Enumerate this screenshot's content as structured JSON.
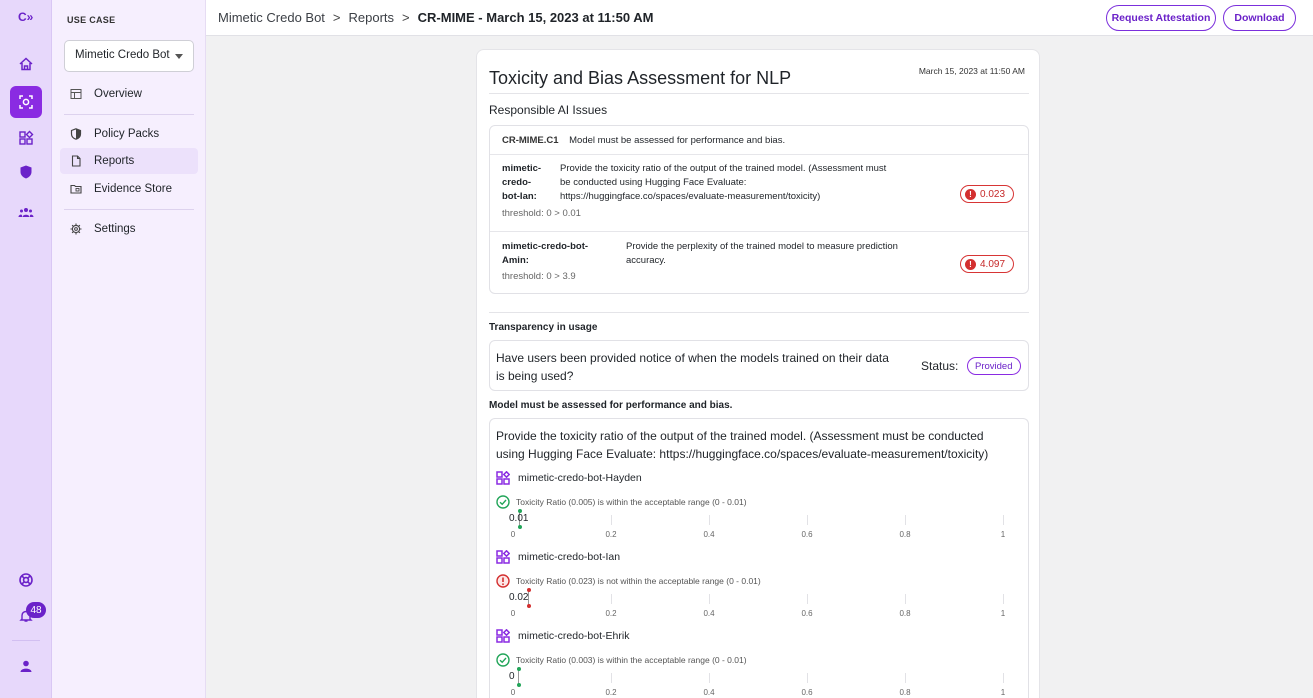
{
  "rail": {
    "logo": "C»",
    "notifications_count": "48"
  },
  "sidebar": {
    "heading": "USE CASE",
    "selected_use_case": "Mimetic Credo Bot",
    "items": [
      {
        "label": "Overview"
      },
      {
        "label": "Policy Packs"
      },
      {
        "label": "Reports"
      },
      {
        "label": "Evidence Store"
      },
      {
        "label": "Settings"
      }
    ]
  },
  "header": {
    "crumb_1": "Mimetic Credo Bot",
    "crumb_2": "Reports",
    "crumb_current": "CR-MIME - March 15, 2023 at 11:50 AM",
    "sep": ">",
    "request_attestation": "Request Attestation",
    "download": "Download"
  },
  "report": {
    "title": "Toxicity and Bias Assessment for NLP",
    "date": "March 15, 2023 at 11:50 AM",
    "issues_heading": "Responsible AI Issues",
    "policy": {
      "id": "CR-MIME.C1",
      "text": "Model must be assessed for performance and bias."
    },
    "issues": [
      {
        "model_1": "mimetic-",
        "model_2": "credo-",
        "model_3": "bot-Ian:",
        "desc_1": "Provide the toxicity ratio of the output of the trained model. (Assessment must",
        "desc_2": "be conducted using Hugging Face Evaluate:",
        "desc_3": "https://huggingface.co/spaces/evaluate-measurement/toxicity)",
        "threshold": "threshold: 0 > 0.01",
        "value": "0.023"
      },
      {
        "model_1": "mimetic-credo-bot-",
        "model_2": "Amin:",
        "desc_1": "Provide the perplexity of the trained model to measure prediction",
        "desc_2": "accuracy.",
        "threshold": "threshold: 0 > 3.9",
        "value": "4.097"
      }
    ],
    "transparency": {
      "heading": "Transparency in usage",
      "question_1": "Have users been provided notice of when the models trained on their data",
      "question_2": "is being used?",
      "status_label": "Status:",
      "status_value": "Provided"
    },
    "performance": {
      "heading": "Model must be assessed for performance and bias.",
      "desc_1": "Provide the toxicity ratio of the output of the trained model. (Assessment must be conducted",
      "desc_2": "using Hugging Face Evaluate: https://huggingface.co/spaces/evaluate-measurement/toxicity)",
      "axis_ticks": [
        "0",
        "0.2",
        "0.4",
        "0.6",
        "0.8",
        "1"
      ],
      "models": [
        {
          "name": "mimetic-credo-bot-Hayden",
          "status": "Toxicity Ratio (0.005) is within the acceptable range (0 - 0.01)",
          "value_label": "0.01",
          "value": 0.005,
          "ok": true
        },
        {
          "name": "mimetic-credo-bot-Ian",
          "status": "Toxicity Ratio (0.023) is not within the acceptable range (0 - 0.01)",
          "value_label": "0.02",
          "value": 0.023,
          "ok": false
        },
        {
          "name": "mimetic-credo-bot-Ehrik",
          "status": "Toxicity Ratio (0.003) is within the acceptable range (0 - 0.01)",
          "value_label": "0",
          "value": 0.003,
          "ok": true
        }
      ]
    }
  },
  "colors": {
    "accent": "#8a2be2",
    "error": "#d32f2f",
    "success": "#22a559"
  }
}
